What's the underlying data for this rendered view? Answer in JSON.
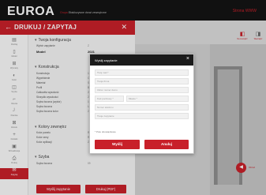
{
  "header": {
    "logo": "EUROA",
    "tagline_brand": "Grupa",
    "tagline_rest": "Ekskluzywne drzwi zewnętrzne",
    "right_link": "Strona WWW"
  },
  "drawer": {
    "title": "DRUKUJ / ZAPYTAJ",
    "rail": [
      {
        "label": "Rodzaj",
        "icon": "layers-icon",
        "glyph": "▤"
      },
      {
        "label": "Model",
        "icon": "door-icon",
        "glyph": "▯"
      },
      {
        "label": "Wymiary",
        "icon": "ruler-icon",
        "glyph": "⊞"
      },
      {
        "label": "Kolor",
        "icon": "palette-icon",
        "glyph": "◐"
      },
      {
        "label": "Szyba",
        "icon": "glass-icon",
        "glyph": "◫"
      },
      {
        "label": "Okucia",
        "icon": "handle-icon",
        "glyph": "⌐"
      },
      {
        "label": "Klamka",
        "icon": "handle-icon",
        "glyph": "┘"
      },
      {
        "label": "Zamek",
        "icon": "lock-icon",
        "glyph": "⊠"
      },
      {
        "label": "Dodatki",
        "icon": "plus-icon",
        "glyph": "+"
      },
      {
        "label": "Wizualizacja",
        "icon": "image-icon",
        "glyph": "▣"
      },
      {
        "label": "Drukuj",
        "icon": "print-icon",
        "glyph": "⎙"
      },
      {
        "label": "Zapytaj",
        "icon": "mail-icon",
        "glyph": "✉"
      }
    ],
    "section_config": "Twoja konfiguracja",
    "config_rows": [
      {
        "k": "Wybór zapytanie",
        "v": "Z"
      },
      {
        "k": "Model",
        "v": "2021"
      }
    ],
    "section_construction": "Konstrukcja",
    "construction_rows": [
      {
        "k": "Konstrukcja",
        "v": "10 płat"
      },
      {
        "k": "Wypełnienie",
        "v": "Okucia"
      },
      {
        "k": "Materiał",
        "v": "Stal"
      },
      {
        "k": "Profil",
        "v": "Barcza"
      },
      {
        "k": "Całkowita wysokość",
        "v": "2080"
      },
      {
        "k": "Skrzydło wysokości",
        "v": "2112 s"
      },
      {
        "k": "Szyba boczna (wybór)",
        "v": "1086"
      },
      {
        "k": "Szyba boczna",
        "v": "Lewa"
      },
      {
        "k": "Szyba boczna kolor",
        "v": "2 x"
      }
    ],
    "section_colors": "Kolory zewnętrz",
    "color_rows": [
      {
        "k": "Kolor panelu",
        "v": "RAL9005"
      },
      {
        "k": "Kolor ramy",
        "v": "RAL9005"
      },
      {
        "k": "Kolor aplikacji",
        "v": "Złoty"
      }
    ],
    "section_glass": "Szyba",
    "glass_rows": [
      {
        "k": "Szyba boczna",
        "v": "09"
      }
    ],
    "btn_send": "Wyślij zapytanie",
    "btn_print": "Drukuj (PDF)"
  },
  "scene": {
    "icon1_label": "Na zewnątrz",
    "icon2_label": "Wewnątrz",
    "fab_label": "Obróć"
  },
  "modal": {
    "title": "Wyślij zapytanie",
    "fields": {
      "name": "Twój mail *",
      "company": "Twoja firma",
      "address": "Ulica i numer domu",
      "postcode": "Kod pocztowy *",
      "city": "Miasto *",
      "phone": "Numer telefonu",
      "message": "Twoje zapytanie"
    },
    "note": "* Pole obowiązkowe",
    "btn_send": "Wyślij",
    "btn_cancel": "Anuluj"
  }
}
